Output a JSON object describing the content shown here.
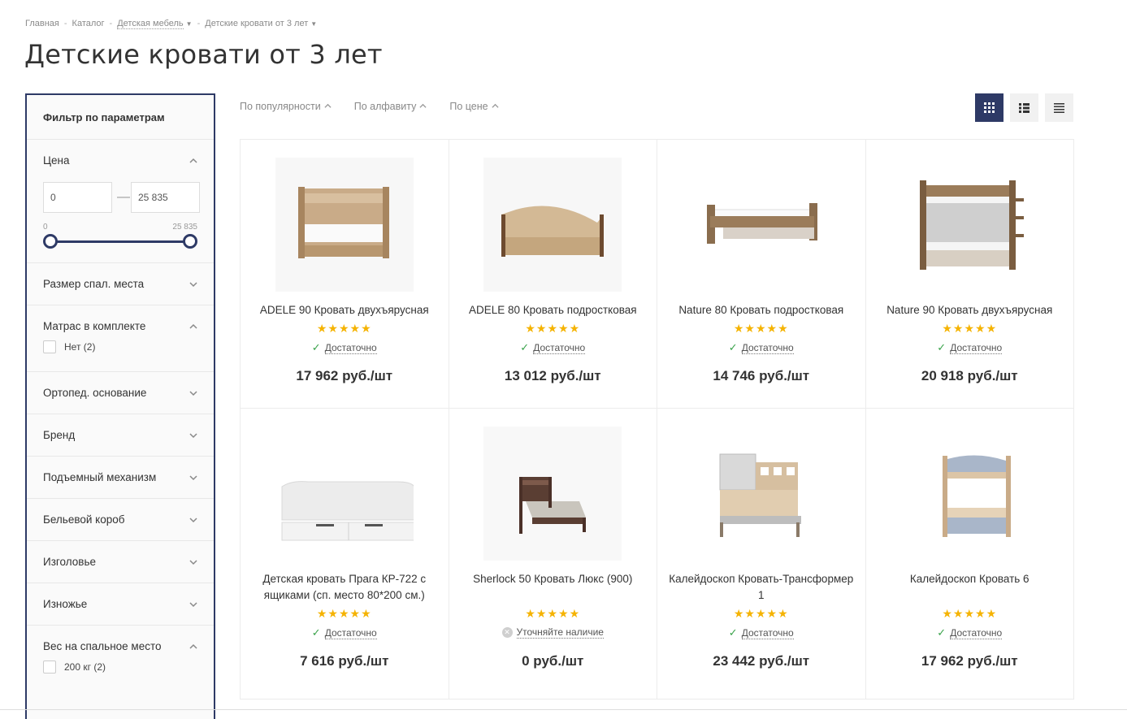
{
  "breadcrumb": {
    "items": [
      "Главная",
      "Каталог",
      "Детская мебель",
      "Детские кровати от 3 лет"
    ]
  },
  "page_title": "Детские кровати от 3 лет",
  "filter": {
    "title": "Фильтр по параметрам",
    "price": {
      "label": "Цена",
      "min_value": "0",
      "max_value": "25 835",
      "min_label": "0",
      "max_label": "25 835"
    },
    "sections": [
      {
        "label": "Размер спал. места"
      },
      {
        "label": "Матрас в комплекте",
        "option": "Нет (2)"
      },
      {
        "label": "Ортопед. основание"
      },
      {
        "label": "Бренд"
      },
      {
        "label": "Подъемный механизм"
      },
      {
        "label": "Бельевой короб"
      },
      {
        "label": "Изголовье"
      },
      {
        "label": "Изножье"
      },
      {
        "label": "Вес на спальное место",
        "option": "200 кг (2)"
      }
    ]
  },
  "sort": {
    "popularity": "По популярности",
    "alphabet": "По алфавиту",
    "price": "По цене"
  },
  "stars": "★★★★★",
  "products": [
    {
      "name": "ADELE 90 Кровать двухъярусная",
      "stock": "Достаточно",
      "price": "17 962 руб./шт"
    },
    {
      "name": "ADELE 80 Кровать подростковая",
      "stock": "Достаточно",
      "price": "13 012 руб./шт"
    },
    {
      "name": "Nature 80 Кровать подростковая",
      "stock": "Достаточно",
      "price": "14 746 руб./шт"
    },
    {
      "name": "Nature 90 Кровать двухъярусная",
      "stock": "Достаточно",
      "price": "20 918 руб./шт"
    },
    {
      "name": "Детская кровать Прага КР-722 с ящиками (сп. место 80*200 см.)",
      "stock": "Достаточно",
      "price": "7 616 руб./шт"
    },
    {
      "name": "Sherlock 50 Кровать Люкс (900)",
      "stock": "Уточняйте наличие",
      "price": "0 руб./шт"
    },
    {
      "name": "Калейдоскоп Кровать-Трансформер 1",
      "stock": "Достаточно",
      "price": "23 442 руб./шт"
    },
    {
      "name": "Калейдоскоп Кровать 6",
      "stock": "Достаточно",
      "price": "17 962 руб./шт"
    }
  ]
}
